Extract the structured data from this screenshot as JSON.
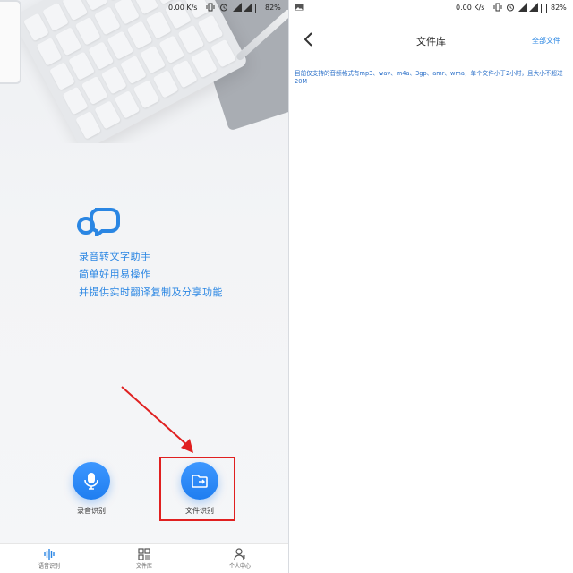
{
  "status_left": {
    "speed": "0.00 K/s",
    "battery": "82%"
  },
  "status_right": {
    "speed": "0.00 K/s",
    "battery": "82%"
  },
  "home": {
    "slogans": [
      "录音转文字助手",
      "简单好用易操作",
      "并提供实时翻译复制及分享功能"
    ],
    "record_label": "录音识别",
    "file_label": "文件识别",
    "accent_color": "#2a86e3",
    "highlight_color": "#e02020"
  },
  "tabbar": [
    {
      "label": "语音识别",
      "icon": "waveform-icon"
    },
    {
      "label": "文件库",
      "icon": "grid-icon"
    },
    {
      "label": "个人中心",
      "icon": "person-icon"
    }
  ],
  "library": {
    "title": "文件库",
    "all_files": "全部文件",
    "notice": "目前仅支持的音频格式有mp3、wav、m4a、3gp、amr、wma，单个文件小于2小时，且大小不超过20M"
  }
}
